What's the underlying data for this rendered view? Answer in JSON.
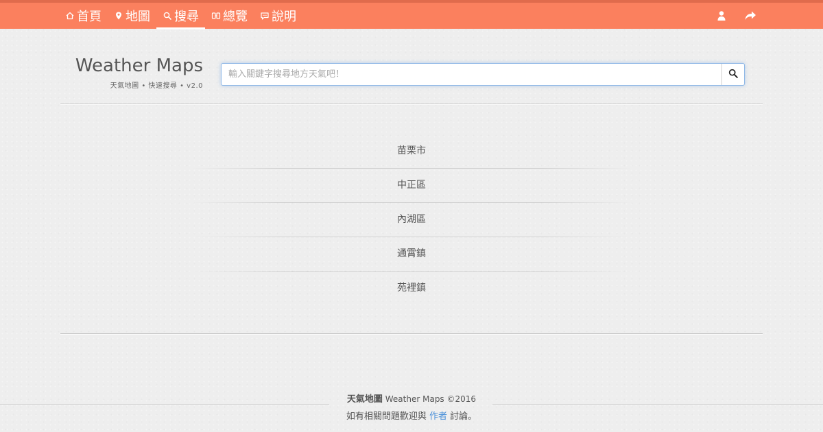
{
  "nav": {
    "items": [
      {
        "label": "首頁",
        "icon": "home-icon",
        "active": false
      },
      {
        "label": "地圖",
        "icon": "map-pin-icon",
        "active": false
      },
      {
        "label": "搜尋",
        "icon": "search-icon",
        "active": true
      },
      {
        "label": "總覽",
        "icon": "overview-icon",
        "active": false
      },
      {
        "label": "說明",
        "icon": "help-chat-icon",
        "active": false
      }
    ],
    "right_icons": [
      "user-icon",
      "share-icon"
    ],
    "colors": {
      "bar": "#fb805e",
      "bar_top": "#e06b4c",
      "text": "#ffffff"
    }
  },
  "brand": {
    "title": "Weather Maps",
    "subtitle": "天氣地圖 • 快速搜尋 • v2.0"
  },
  "search": {
    "placeholder": "輸入關鍵字搜尋地方天氣吧！",
    "value": "",
    "button_icon": "search-icon",
    "focus_color": "#8fb8e6"
  },
  "results": [
    "苗栗市",
    "中正區",
    "內湖區",
    "通霄鎮",
    "苑裡鎮"
  ],
  "footer": {
    "brand_cn": "天氣地圖",
    "brand_en": "Weather Maps",
    "copyright": "©2016",
    "contact_prefix": "如有相關問題歡迎與",
    "contact_link": "作者",
    "contact_suffix": "討論。",
    "link_color": "#4a90d9"
  }
}
